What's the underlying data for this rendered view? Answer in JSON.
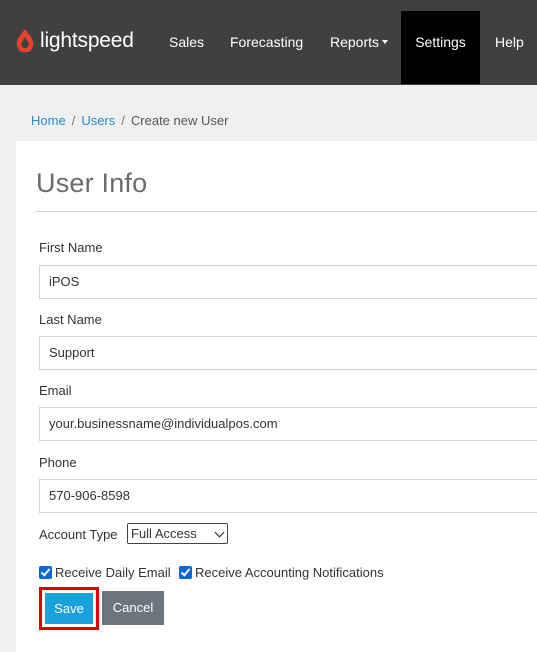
{
  "header": {
    "brand": "lightspeed",
    "nav": {
      "sales": "Sales",
      "forecasting": "Forecasting",
      "reports": "Reports",
      "settings": "Settings",
      "help": "Help"
    }
  },
  "breadcrumb": {
    "home": "Home",
    "users": "Users",
    "current": "Create new User"
  },
  "form": {
    "title": "User Info",
    "first_name": {
      "label": "First Name",
      "value": "iPOS"
    },
    "last_name": {
      "label": "Last Name",
      "value": "Support"
    },
    "email": {
      "label": "Email",
      "value": "your.businessname@individualpos.com"
    },
    "phone": {
      "label": "Phone",
      "value": "570-906-8598"
    },
    "account_type": {
      "label": "Account Type",
      "value": "Full Access"
    },
    "receive_daily_email": {
      "label": "Receive Daily Email",
      "checked": true
    },
    "receive_accounting": {
      "label": "Receive Accounting Notifications",
      "checked": true
    },
    "save_label": "Save",
    "cancel_label": "Cancel"
  },
  "colors": {
    "navbar": "#404040",
    "brand_accent": "#e8412c",
    "link": "#2a8bc5",
    "save": "#1aa1dc",
    "cancel": "#6c757d",
    "highlight": "#dd0000"
  }
}
